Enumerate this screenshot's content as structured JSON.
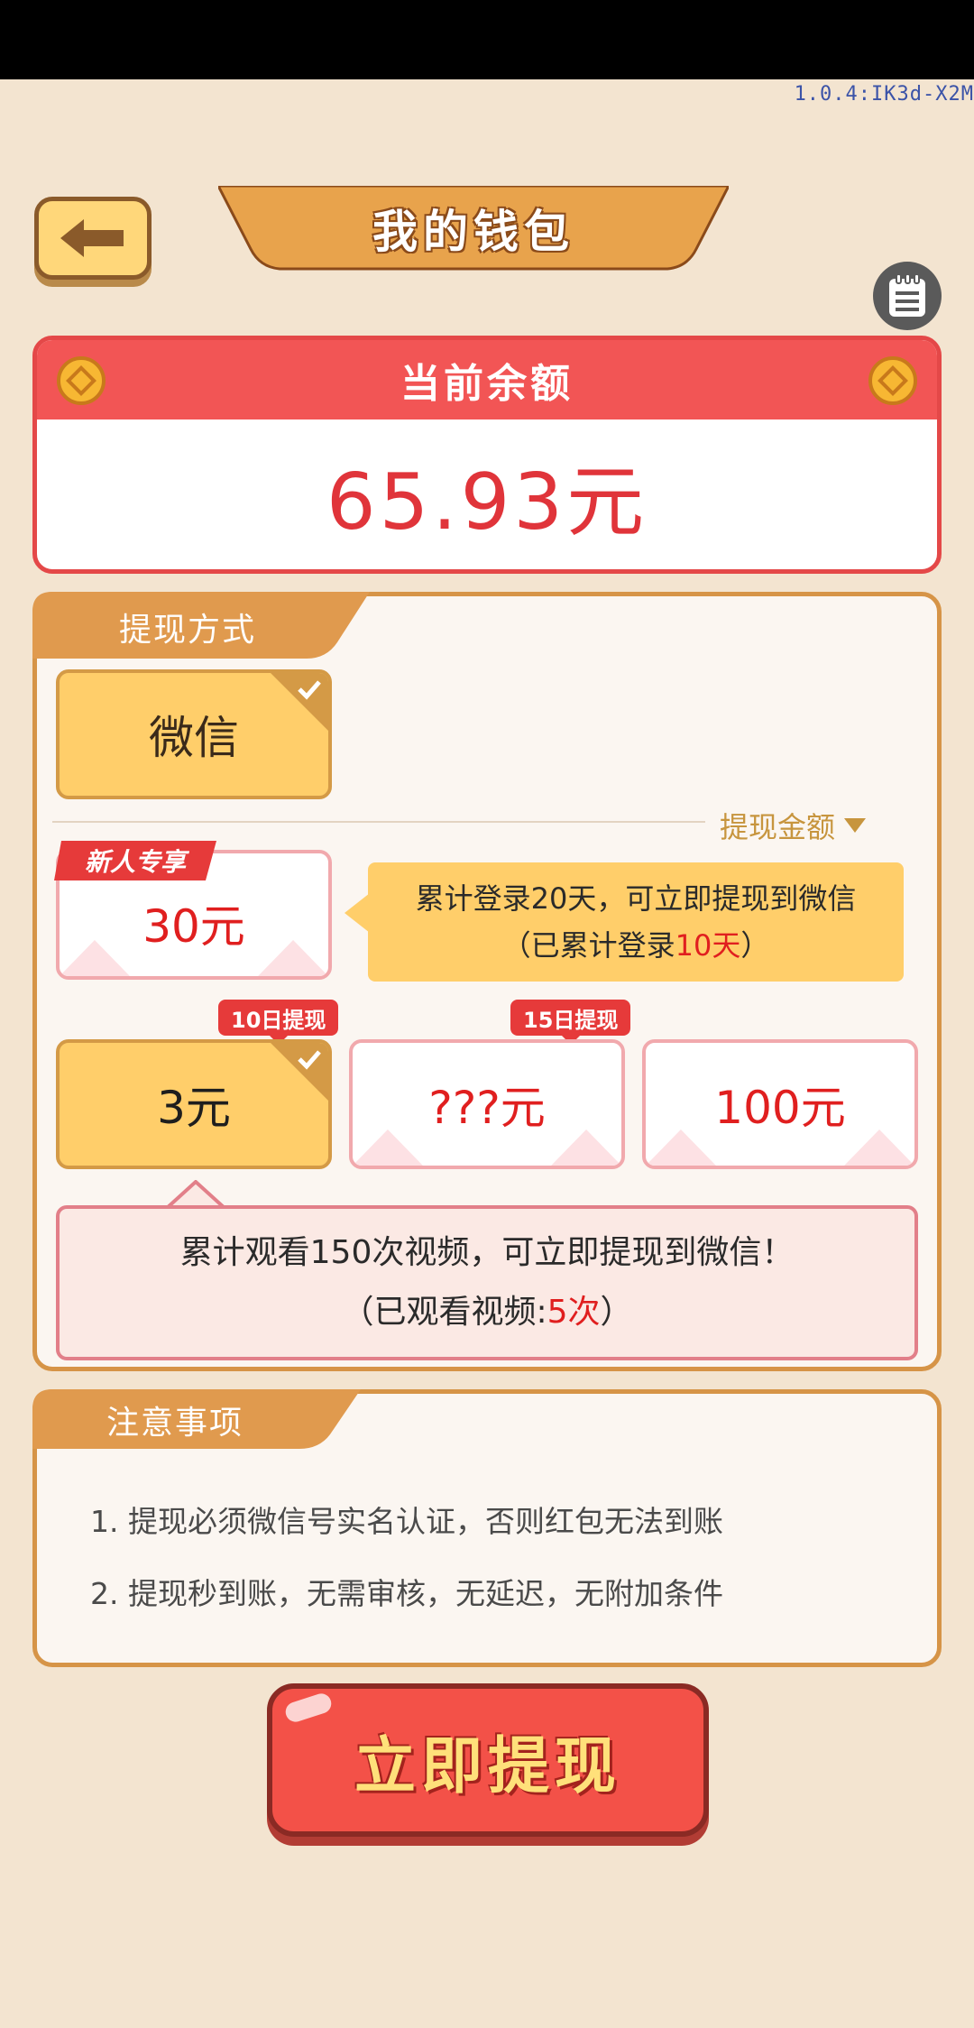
{
  "app": {
    "version": "1.0.4:IK3d-X2M"
  },
  "header": {
    "title": "我的钱包"
  },
  "balance": {
    "label": "当前余额",
    "value": "65.93元"
  },
  "withdraw": {
    "method_tab": "提现方式",
    "method": "微信",
    "amount_label": "提现金额",
    "new_user_badge": "新人专享",
    "amounts": {
      "new_user": "30元",
      "a1": "3元",
      "a2": "???元",
      "a3": "100元"
    },
    "badges": {
      "a1": "10日提现",
      "a2": "15日提现"
    },
    "login_tip": {
      "line1": "累计登录20天，可立即提现到微信",
      "line2_prefix": "（已累计登录",
      "line2_value": "10天",
      "line2_suffix": "）"
    },
    "video_tip": {
      "line1": "累计观看150次视频，可立即提现到微信！",
      "line2_prefix": "（已观看视频:",
      "line2_value": "5次",
      "line2_suffix": "）"
    }
  },
  "notes": {
    "tab": "注意事项",
    "items": [
      "1. 提现必须微信号实名认证，否则红包无法到账",
      "2. 提现秒到账，无需审核，无延迟，无附加条件"
    ]
  },
  "cta": {
    "label": "立即提现"
  },
  "colors": {
    "accent_red": "#f25555",
    "accent_orange": "#d69447",
    "card_yellow": "#ffce6a",
    "text_red": "#e01f1f"
  }
}
